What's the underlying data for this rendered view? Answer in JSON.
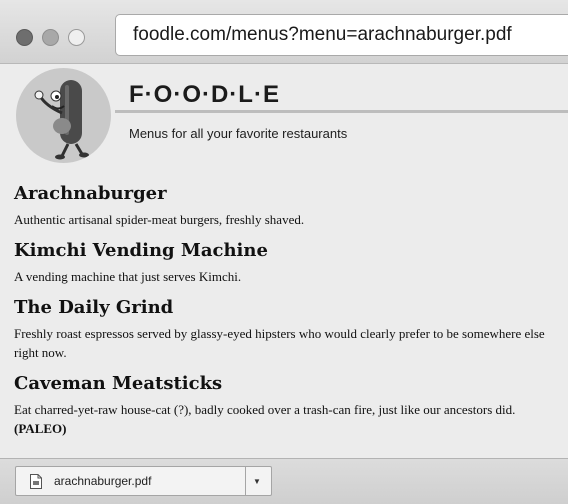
{
  "browser": {
    "url": "foodle.com/menus?menu=arachnaburger.pdf"
  },
  "header": {
    "brand": "F·O·O·D·L·E",
    "tagline": "Menus for all your favorite restaurants"
  },
  "restaurants": [
    {
      "name": "Arachnaburger",
      "description": "Authentic artisanal spider-meat burgers, freshly shaved."
    },
    {
      "name": "Kimchi Vending Machine",
      "description": "A vending machine that just serves Kimchi."
    },
    {
      "name": "The Daily Grind",
      "description": "Freshly roast espressos served by glassy-eyed hipsters who would clearly prefer to be somewhere else right now."
    },
    {
      "name": "Caveman Meatsticks",
      "description": "Eat charred-yet-raw house-cat (?), badly cooked over a trash-can fire, just like our ancestors did.",
      "tag": "(PALEO)"
    }
  ],
  "download": {
    "filename": "arachnaburger.pdf",
    "icon": "pdf-file-icon"
  },
  "colors": {
    "page_background": "#ececec",
    "chrome": "#d9d9d9",
    "logo_circle": "#c9c9c9"
  }
}
